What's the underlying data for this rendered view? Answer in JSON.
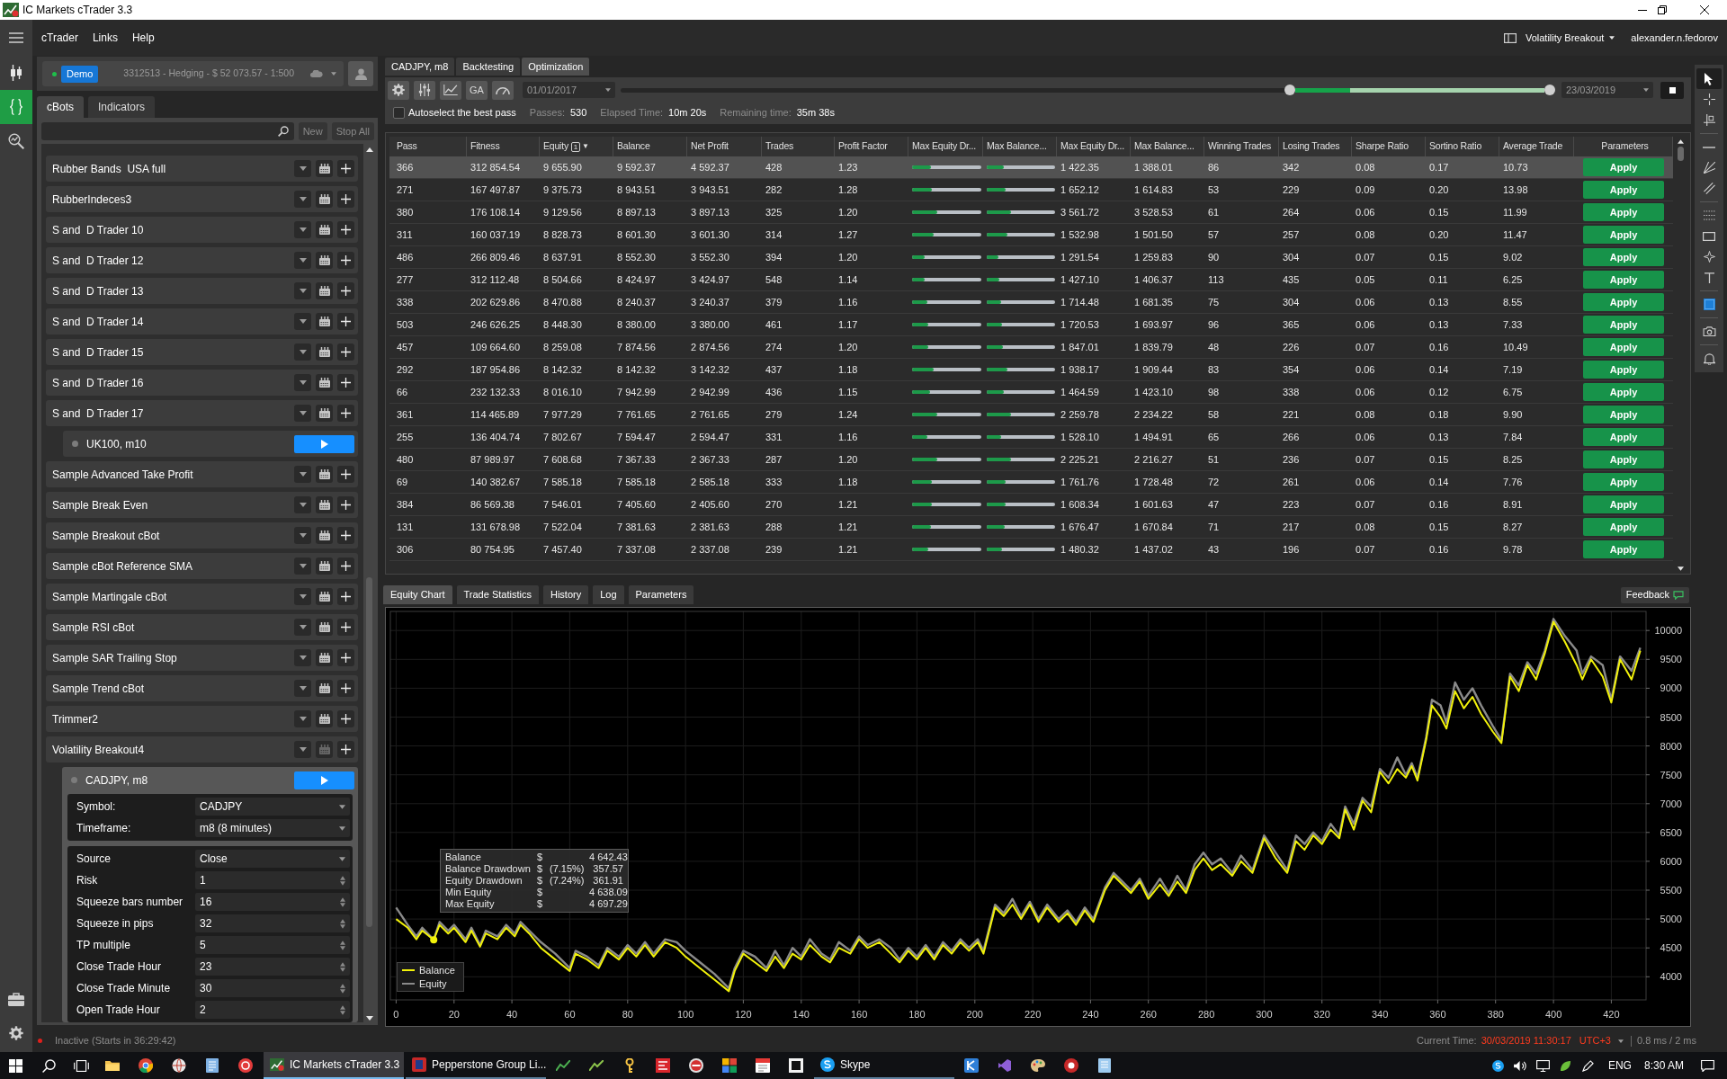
{
  "window": {
    "title": "IC Markets cTrader 3.3"
  },
  "nav_rail": {
    "items": [
      {
        "selected": false
      },
      {
        "selected": true
      },
      {
        "selected": false
      }
    ]
  },
  "menu_bar": {
    "menus": [
      "cTrader",
      "Links",
      "Help"
    ],
    "workspace": "Volatility Breakout",
    "user": "alexander.n.fedorov"
  },
  "account": {
    "connected": true,
    "mode": "Demo",
    "summary": "3312513 - Hedging - $ 52 073.57 - 1:500"
  },
  "cbots_panel": {
    "tabs": [
      {
        "label": "cBots",
        "selected": true
      },
      {
        "label": "Indicators",
        "selected": false
      }
    ],
    "buttons": [
      {
        "label": "New",
        "disabled": true
      },
      {
        "label": "Stop All",
        "disabled": true
      }
    ],
    "items": [
      {
        "name": "Rubber Bands  USA full",
        "backtest_enabled": true
      },
      {
        "name": "RubberIndeces3",
        "backtest_enabled": true
      },
      {
        "name": "S and  D Trader 10",
        "backtest_enabled": true
      },
      {
        "name": "S and  D Trader 12",
        "backtest_enabled": true
      },
      {
        "name": "S and  D Trader 13",
        "backtest_enabled": true
      },
      {
        "name": "S and  D Trader 14",
        "backtest_enabled": true
      },
      {
        "name": "S and  D Trader 15",
        "backtest_enabled": true
      },
      {
        "name": "S and  D Trader 16",
        "backtest_enabled": true
      },
      {
        "name": "S and  D Trader 17",
        "backtest_enabled": true,
        "instances": [
          {
            "label": "UK100, m10",
            "running": false,
            "selected": false
          }
        ]
      },
      {
        "name": "Sample Advanced Take Profit",
        "backtest_enabled": true
      },
      {
        "name": "Sample Break Even",
        "backtest_enabled": true
      },
      {
        "name": "Sample Breakout cBot",
        "backtest_enabled": true
      },
      {
        "name": "Sample cBot Reference SMA",
        "backtest_enabled": true
      },
      {
        "name": "Sample Martingale cBot",
        "backtest_enabled": true
      },
      {
        "name": "Sample RSI cBot",
        "backtest_enabled": true
      },
      {
        "name": "Sample SAR Trailing Stop",
        "backtest_enabled": true
      },
      {
        "name": "Sample Trend cBot",
        "backtest_enabled": true
      },
      {
        "name": "Trimmer2",
        "backtest_enabled": true
      },
      {
        "name": "Volatility Breakout4",
        "backtest_enabled": false,
        "instances": [
          {
            "label": "CADJPY, m8",
            "running": false,
            "selected": true,
            "settings": [
              {
                "label": "Symbol:",
                "value": "CADJPY",
                "kind": "dropdown"
              },
              {
                "label": "Timeframe:",
                "value": "m8 (8 minutes)",
                "kind": "dropdown"
              }
            ],
            "parameters": [
              {
                "label": "Source",
                "value": "Close",
                "kind": "dropdown"
              },
              {
                "label": "Risk",
                "value": "1",
                "kind": "spinner"
              },
              {
                "label": "Squeeze bars number",
                "value": "16",
                "kind": "spinner"
              },
              {
                "label": "Squeeze in pips",
                "value": "32",
                "kind": "spinner"
              },
              {
                "label": "TP multiple",
                "value": "5",
                "kind": "spinner"
              },
              {
                "label": "Close Trade Hour",
                "value": "23",
                "kind": "spinner"
              },
              {
                "label": "Close Trade Minute",
                "value": "30",
                "kind": "spinner"
              },
              {
                "label": "Open Trade Hour",
                "value": "2",
                "kind": "spinner"
              }
            ]
          }
        ]
      }
    ]
  },
  "status_bar": {
    "connected": false,
    "text": "Inactive (Starts in 36:29:42)",
    "clock_label": "Current Time:",
    "clock": "30/03/2019 11:30:17",
    "timezone": "UTC+3",
    "latency": "0.8 ms / 2 ms"
  },
  "instance_tabs": [
    {
      "label": "CADJPY, m8",
      "selected": false
    },
    {
      "label": "Backtesting",
      "selected": false
    },
    {
      "label": "Optimization",
      "selected": true
    }
  ],
  "optimization": {
    "ga_label": "GA",
    "start_date": "01/01/2017",
    "end_date": "23/03/2019",
    "period": {
      "start": {
        "level": 0.72
      },
      "end": {
        "level": 1
      },
      "progress": {
        "level": 0.22
      }
    },
    "autoselect": {
      "label": "Autoselect the best pass",
      "checked": false
    },
    "stats": [
      {
        "label": "Passes:",
        "value": "530"
      },
      {
        "label": "Elapsed Time:",
        "value": "10m 20s"
      },
      {
        "label": "Remaining time:",
        "value": "35m 38s"
      }
    ]
  },
  "results_table": {
    "columns": [
      {
        "label": "Pass",
        "kind": "text"
      },
      {
        "label": "Fitness",
        "kind": "text"
      },
      {
        "label": "Equity",
        "kind": "text",
        "sort_rank": "1",
        "sort_arrow": "▼"
      },
      {
        "label": "Balance",
        "kind": "text"
      },
      {
        "label": "Net Profit",
        "kind": "text"
      },
      {
        "label": "Trades",
        "kind": "text"
      },
      {
        "label": "Profit Factor",
        "kind": "text"
      },
      {
        "label": "Max Equity Dr...",
        "kind": "bar"
      },
      {
        "label": "Max Balance...",
        "kind": "bar"
      },
      {
        "label": "Max Equity Dr...",
        "kind": "text"
      },
      {
        "label": "Max Balance...",
        "kind": "text"
      },
      {
        "label": "Winning Trades",
        "kind": "text"
      },
      {
        "label": "Losing Trades",
        "kind": "text"
      },
      {
        "label": "Sharpe Ratio",
        "kind": "text"
      },
      {
        "label": "Sortino Ratio",
        "kind": "text"
      },
      {
        "label": "Average Trade",
        "kind": "text"
      },
      {
        "label": "Parameters",
        "kind": "action"
      }
    ],
    "rows": [
      {
        "selected": true,
        "cells": [
          "366",
          "312 854.54",
          "9 655.90",
          "9 592.37",
          "4 592.37",
          "428",
          "1.23",
          {
            "level": 0.27
          },
          {
            "level": 0.25
          },
          "1 422.35",
          "1 388.01",
          "86",
          "342",
          "0.08",
          "0.17",
          "10.73",
          "Apply"
        ]
      },
      {
        "selected": false,
        "cells": [
          "271",
          "167 497.87",
          "9 375.73",
          "8 943.51",
          "3 943.51",
          "282",
          "1.28",
          {
            "level": 0.29
          },
          {
            "level": 0.27
          },
          "1 652.12",
          "1 614.83",
          "53",
          "229",
          "0.09",
          "0.20",
          "13.98",
          "Apply"
        ]
      },
      {
        "selected": false,
        "cells": [
          "380",
          "176 108.14",
          "9 129.56",
          "8 897.13",
          "3 897.13",
          "325",
          "1.20",
          {
            "level": 0.36
          },
          {
            "level": 0.35
          },
          "3 561.72",
          "3 528.53",
          "61",
          "264",
          "0.06",
          "0.15",
          "11.99",
          "Apply"
        ]
      },
      {
        "selected": false,
        "cells": [
          "311",
          "160 037.19",
          "8 828.73",
          "8 601.30",
          "3 601.30",
          "314",
          "1.27",
          {
            "level": 0.31
          },
          {
            "level": 0.3
          },
          "1 532.98",
          "1 501.50",
          "57",
          "257",
          "0.08",
          "0.20",
          "11.47",
          "Apply"
        ]
      },
      {
        "selected": false,
        "cells": [
          "486",
          "266 809.46",
          "8 637.91",
          "8 552.30",
          "3 552.30",
          "394",
          "1.20",
          {
            "level": 0.18
          },
          {
            "level": 0.17
          },
          "1 291.54",
          "1 259.83",
          "90",
          "304",
          "0.07",
          "0.15",
          "9.02",
          "Apply"
        ]
      },
      {
        "selected": false,
        "cells": [
          "277",
          "312 112.48",
          "8 504.66",
          "8 424.97",
          "3 424.97",
          "548",
          "1.14",
          {
            "level": 0.18
          },
          {
            "level": 0.18
          },
          "1 427.10",
          "1 406.37",
          "113",
          "435",
          "0.05",
          "0.11",
          "6.25",
          "Apply"
        ]
      },
      {
        "selected": false,
        "cells": [
          "338",
          "202 629.86",
          "8 470.88",
          "8 240.37",
          "3 240.37",
          "379",
          "1.16",
          {
            "level": 0.22
          },
          {
            "level": 0.21
          },
          "1 714.48",
          "1 681.35",
          "75",
          "304",
          "0.06",
          "0.13",
          "8.55",
          "Apply"
        ]
      },
      {
        "selected": false,
        "cells": [
          "503",
          "246 626.25",
          "8 448.30",
          "8 380.00",
          "3 380.00",
          "461",
          "1.17",
          {
            "level": 0.24
          },
          {
            "level": 0.23
          },
          "1 720.53",
          "1 693.97",
          "96",
          "365",
          "0.06",
          "0.13",
          "7.33",
          "Apply"
        ]
      },
      {
        "selected": false,
        "cells": [
          "457",
          "109 664.60",
          "8 259.08",
          "7 874.56",
          "2 874.56",
          "274",
          "1.20",
          {
            "level": 0.24
          },
          {
            "level": 0.24
          },
          "1 847.01",
          "1 839.79",
          "48",
          "226",
          "0.07",
          "0.16",
          "10.49",
          "Apply"
        ]
      },
      {
        "selected": false,
        "cells": [
          "292",
          "187 954.86",
          "8 142.32",
          "8 142.32",
          "3 142.32",
          "437",
          "1.18",
          {
            "level": 0.31
          },
          {
            "level": 0.3
          },
          "1 938.17",
          "1 909.44",
          "83",
          "354",
          "0.06",
          "0.14",
          "7.19",
          "Apply"
        ]
      },
      {
        "selected": false,
        "cells": [
          "66",
          "232 132.33",
          "8 016.10",
          "7 942.99",
          "2 942.99",
          "436",
          "1.15",
          {
            "level": 0.26
          },
          {
            "level": 0.25
          },
          "1 464.59",
          "1 423.10",
          "98",
          "338",
          "0.06",
          "0.12",
          "6.75",
          "Apply"
        ]
      },
      {
        "selected": false,
        "cells": [
          "361",
          "114 465.89",
          "7 977.29",
          "7 761.65",
          "2 761.65",
          "279",
          "1.24",
          {
            "level": 0.36
          },
          {
            "level": 0.36
          },
          "2 259.78",
          "2 234.22",
          "58",
          "221",
          "0.08",
          "0.18",
          "9.90",
          "Apply"
        ]
      },
      {
        "selected": false,
        "cells": [
          "255",
          "136 404.74",
          "7 802.67",
          "7 594.47",
          "2 594.47",
          "331",
          "1.16",
          {
            "level": 0.22
          },
          {
            "level": 0.21
          },
          "1 528.10",
          "1 494.91",
          "65",
          "266",
          "0.06",
          "0.13",
          "7.84",
          "Apply"
        ]
      },
      {
        "selected": false,
        "cells": [
          "480",
          "87 989.97",
          "7 608.68",
          "7 367.33",
          "2 367.33",
          "287",
          "1.20",
          {
            "level": 0.36
          },
          {
            "level": 0.36
          },
          "2 225.21",
          "2 216.27",
          "51",
          "236",
          "0.07",
          "0.15",
          "8.25",
          "Apply"
        ]
      },
      {
        "selected": false,
        "cells": [
          "69",
          "140 382.67",
          "7 585.18",
          "7 585.18",
          "2 585.18",
          "333",
          "1.18",
          {
            "level": 0.29
          },
          {
            "level": 0.28
          },
          "1 761.76",
          "1 728.48",
          "72",
          "261",
          "0.06",
          "0.14",
          "7.76",
          "Apply"
        ]
      },
      {
        "selected": false,
        "cells": [
          "384",
          "86 569.38",
          "7 546.01",
          "7 405.60",
          "2 405.60",
          "270",
          "1.21",
          {
            "level": 0.29
          },
          {
            "level": 0.28
          },
          "1 608.34",
          "1 601.63",
          "47",
          "223",
          "0.07",
          "0.16",
          "8.91",
          "Apply"
        ]
      },
      {
        "selected": false,
        "cells": [
          "131",
          "131 678.98",
          "7 522.04",
          "7 381.63",
          "2 381.63",
          "288",
          "1.21",
          {
            "level": 0.27
          },
          {
            "level": 0.26
          },
          "1 676.47",
          "1 670.84",
          "71",
          "217",
          "0.08",
          "0.15",
          "8.27",
          "Apply"
        ]
      },
      {
        "selected": false,
        "cells": [
          "306",
          "80 754.95",
          "7 457.40",
          "7 337.08",
          "2 337.08",
          "239",
          "1.21",
          {
            "level": 0.24
          },
          {
            "level": 0.23
          },
          "1 480.32",
          "1 437.02",
          "43",
          "196",
          "0.07",
          "0.16",
          "9.78",
          "Apply"
        ]
      }
    ]
  },
  "result_tabs": [
    {
      "label": "Equity Chart",
      "selected": true
    },
    {
      "label": "Trade Statistics",
      "selected": false
    },
    {
      "label": "History",
      "selected": false
    },
    {
      "label": "Log",
      "selected": false
    },
    {
      "label": "Parameters",
      "selected": false
    }
  ],
  "feedback": "Feedback",
  "equity_chart": {
    "chart_data": {
      "type": "line",
      "grid": true,
      "legend": "lower left",
      "x": [
        0,
        4,
        7,
        9,
        13,
        15,
        18,
        20,
        24,
        26,
        29,
        31,
        35,
        38,
        41,
        43,
        46,
        50,
        55,
        60,
        62,
        66,
        70,
        73,
        77,
        80,
        83,
        86,
        89,
        93,
        97,
        100,
        105,
        110,
        115,
        117,
        120,
        124,
        128,
        131,
        134,
        137,
        140,
        143,
        147,
        150,
        153,
        157,
        160,
        163,
        167,
        171,
        174,
        177,
        180,
        183,
        186,
        189,
        192,
        195,
        198,
        201,
        203,
        207,
        210,
        213,
        216,
        219,
        222,
        225,
        229,
        232,
        235,
        238,
        241,
        245,
        248,
        251,
        254,
        257,
        260,
        264,
        267,
        270,
        273,
        276,
        279,
        282,
        285,
        289,
        292,
        296,
        300,
        304,
        308,
        311,
        314,
        317,
        320,
        323,
        326,
        328,
        331,
        334,
        337,
        340,
        343,
        346,
        349,
        351,
        353,
        356,
        358,
        361,
        363,
        366,
        369,
        372,
        375,
        379,
        382,
        385,
        388,
        391,
        394,
        397,
        400,
        404,
        408,
        410,
        413,
        417,
        420,
        423,
        427,
        430
      ],
      "series": [
        {
          "name": "Balance",
          "color": "#f2f20a",
          "values": [
            5000,
            4850,
            4650,
            4800,
            4640,
            4900,
            4750,
            4850,
            4600,
            4800,
            4520,
            4750,
            4650,
            4850,
            4700,
            4900,
            4750,
            4500,
            4300,
            4100,
            4400,
            4300,
            4150,
            4450,
            4300,
            4500,
            4350,
            4550,
            4350,
            4600,
            4500,
            4350,
            4150,
            3950,
            3750,
            4100,
            4400,
            4250,
            4100,
            4350,
            4150,
            4400,
            4300,
            4550,
            4350,
            4250,
            4500,
            4400,
            4650,
            4500,
            4600,
            4400,
            4250,
            4450,
            4300,
            4500,
            4300,
            4550,
            4400,
            4600,
            4450,
            4600,
            4400,
            5200,
            5050,
            5250,
            5000,
            5250,
            4950,
            5200,
            4950,
            5100,
            4900,
            5150,
            4950,
            5500,
            5750,
            5600,
            5450,
            5650,
            5350,
            5600,
            5400,
            5650,
            5450,
            5850,
            6050,
            5850,
            5950,
            5750,
            6000,
            5800,
            6400,
            6050,
            5800,
            6350,
            6200,
            6450,
            6300,
            6550,
            6400,
            6900,
            6550,
            7050,
            6850,
            7550,
            7350,
            7600,
            7450,
            7650,
            7400,
            8100,
            8700,
            8500,
            8300,
            8950,
            8650,
            8850,
            8550,
            8250,
            8050,
            9200,
            8950,
            9400,
            9150,
            9600,
            10150,
            9800,
            9400,
            9150,
            9500,
            9200,
            8750,
            9500,
            9150,
            9650
          ]
        },
        {
          "name": "Equity",
          "color": "#8a8a8a",
          "values": [
            5200,
            4900,
            4700,
            4850,
            4640,
            4950,
            4800,
            4900,
            4650,
            4850,
            4550,
            4800,
            4700,
            4900,
            4750,
            4950,
            4800,
            4600,
            4400,
            4150,
            4450,
            4350,
            4200,
            4500,
            4350,
            4550,
            4400,
            4600,
            4400,
            4650,
            4600,
            4450,
            4250,
            4050,
            3800,
            4150,
            4450,
            4350,
            4150,
            4450,
            4200,
            4500,
            4350,
            4650,
            4400,
            4300,
            4600,
            4450,
            4700,
            4550,
            4650,
            4500,
            4300,
            4500,
            4350,
            4550,
            4350,
            4600,
            4450,
            4650,
            4500,
            4650,
            4450,
            5250,
            5100,
            5350,
            5050,
            5300,
            5000,
            5250,
            5000,
            5150,
            4950,
            5200,
            5000,
            5550,
            5800,
            5650,
            5500,
            5700,
            5400,
            5700,
            5450,
            5750,
            5500,
            5950,
            6150,
            5950,
            6050,
            5800,
            6100,
            5850,
            6450,
            6150,
            5850,
            6450,
            6300,
            6500,
            6350,
            6650,
            6450,
            6950,
            6650,
            7100,
            6950,
            7600,
            7450,
            7800,
            7500,
            7700,
            7450,
            8150,
            8800,
            8700,
            8400,
            9100,
            8800,
            9000,
            8700,
            8350,
            8100,
            9250,
            9050,
            9450,
            9250,
            9650,
            10200,
            9900,
            9650,
            9250,
            9550,
            9400,
            8800,
            9550,
            9300,
            9700
          ]
        }
      ],
      "xlim": [
        -2,
        432
      ],
      "ylim": [
        3600,
        10330
      ],
      "xticks": [
        0,
        20,
        40,
        60,
        80,
        100,
        120,
        140,
        160,
        180,
        200,
        220,
        240,
        260,
        280,
        300,
        320,
        340,
        360,
        {
          "value": 380,
          "label": "380"
        },
        400,
        420
      ],
      "yticks": [
        4000,
        4500,
        5000,
        5500,
        6000,
        6500,
        7000,
        7500,
        8000,
        8500,
        9000,
        9500,
        10000
      ]
    },
    "tooltip": [
      {
        "label": "Balance",
        "currency": "$",
        "value": "4 642.43"
      },
      {
        "label": "Balance Drawdown",
        "currency": "$",
        "percent": "(7.15%)",
        "value": "357.57"
      },
      {
        "label": "Equity Drawdown",
        "currency": "$",
        "percent": "(7.24%)",
        "value": "361.91"
      },
      {
        "label": "Min Equity",
        "currency": "$",
        "value": "4 638.09"
      },
      {
        "label": "Max Equity",
        "currency": "$",
        "value": "4 697.29"
      }
    ]
  },
  "drawing_tools": [
    {
      "selected": true
    },
    {
      "selected": false
    },
    {
      "selected": false
    },
    {
      "selected": false
    },
    {
      "selected": false
    },
    {
      "selected": false
    },
    {
      "selected": false
    },
    {
      "selected": false
    },
    {
      "selected": false
    },
    {
      "selected": false
    },
    {
      "selected": false
    },
    {
      "selected": false
    },
    {
      "selected": false
    }
  ],
  "taskbar": {
    "items": [
      {
        "kind": "icon"
      },
      {
        "kind": "icon"
      },
      {
        "kind": "icon"
      },
      {
        "kind": "icon"
      },
      {
        "kind": "icon"
      },
      {
        "kind": "window",
        "label": "IC Markets cTrader 3.3",
        "active": true
      },
      {
        "kind": "window",
        "label": "Pepperstone Group Li...",
        "active": false
      },
      {
        "kind": "icon"
      },
      {
        "kind": "icon"
      },
      {
        "kind": "icon"
      },
      {
        "kind": "icon"
      },
      {
        "kind": "icon"
      },
      {
        "kind": "icon"
      },
      {
        "kind": "icon"
      },
      {
        "kind": "icon"
      },
      {
        "kind": "window",
        "label": "Skype",
        "active": false
      },
      {
        "kind": "icon"
      },
      {
        "kind": "icon"
      },
      {
        "kind": "icon"
      },
      {
        "kind": "icon"
      },
      {
        "kind": "icon"
      }
    ],
    "language": "ENG",
    "time": "8:30 AM"
  }
}
